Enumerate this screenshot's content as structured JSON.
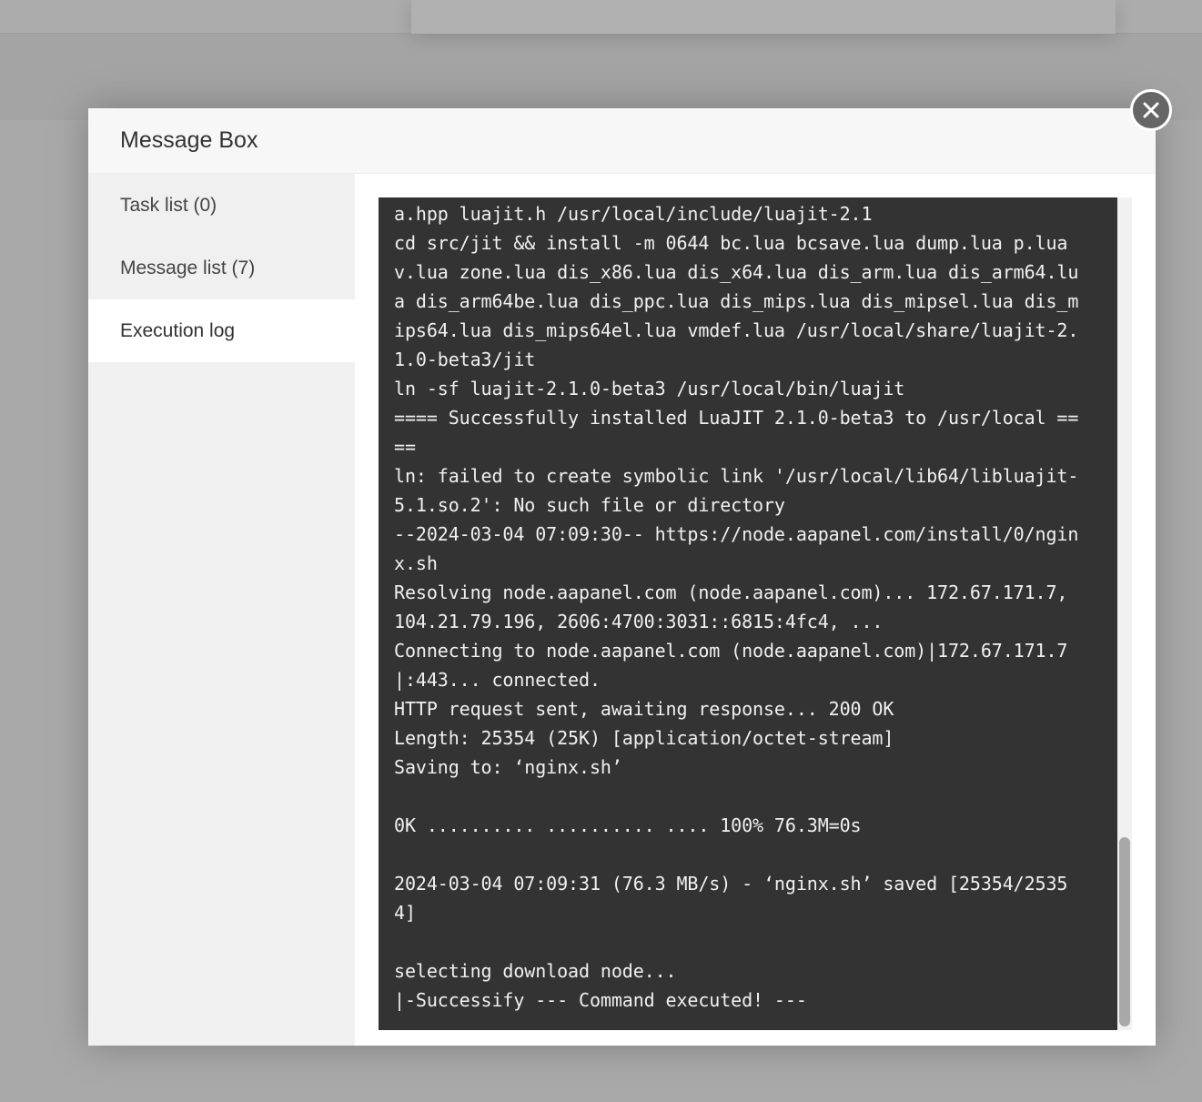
{
  "modal": {
    "title": "Message Box",
    "tabs": [
      {
        "label": "Task list (0)"
      },
      {
        "label": "Message list (7)"
      },
      {
        "label": "Execution log"
      }
    ],
    "log_lines": [
      "a.hpp luajit.h /usr/local/include/luajit-2.1",
      "cd src/jit && install -m 0644 bc.lua bcsave.lua dump.lua p.lua",
      "v.lua zone.lua dis_x86.lua dis_x64.lua dis_arm.lua dis_arm64.lu",
      "a dis_arm64be.lua dis_ppc.lua dis_mips.lua dis_mipsel.lua dis_m",
      "ips64.lua dis_mips64el.lua vmdef.lua /usr/local/share/luajit-2.",
      "1.0-beta3/jit",
      "ln -sf luajit-2.1.0-beta3 /usr/local/bin/luajit",
      "==== Successfully installed LuaJIT 2.1.0-beta3 to /usr/local ==",
      "==",
      "ln: failed to create symbolic link '/usr/local/lib64/libluajit-",
      "5.1.so.2': No such file or directory",
      "--2024-03-04 07:09:30-- https://node.aapanel.com/install/0/ngin",
      "x.sh",
      "Resolving node.aapanel.com (node.aapanel.com)... 172.67.171.7,",
      "104.21.79.196, 2606:4700:3031::6815:4fc4, ...",
      "Connecting to node.aapanel.com (node.aapanel.com)|172.67.171.7",
      "|:443... connected.",
      "HTTP request sent, awaiting response... 200 OK",
      "Length: 25354 (25K) [application/octet-stream]",
      "Saving to: ‘nginx.sh’",
      "",
      "0K .......... .......... .... 100% 76.3M=0s",
      "",
      "2024-03-04 07:09:31 (76.3 MB/s) - ‘nginx.sh’ saved [25354/2535",
      "4]",
      "",
      "selecting download node...",
      "|-Successify --- Command executed! ---"
    ]
  },
  "icons": {
    "close": "close-icon"
  }
}
